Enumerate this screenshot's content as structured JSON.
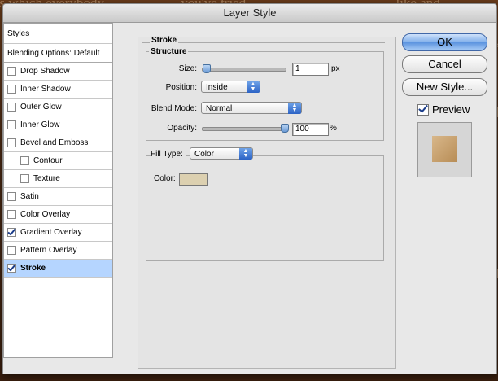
{
  "window": {
    "title": "Layer Style"
  },
  "styles_list": {
    "header": "Styles",
    "blending_options": "Blending Options: Default",
    "items": [
      {
        "label": "Drop Shadow",
        "checked": false,
        "indent": false
      },
      {
        "label": "Inner Shadow",
        "checked": false,
        "indent": false
      },
      {
        "label": "Outer Glow",
        "checked": false,
        "indent": false
      },
      {
        "label": "Inner Glow",
        "checked": false,
        "indent": false
      },
      {
        "label": "Bevel and Emboss",
        "checked": false,
        "indent": false
      },
      {
        "label": "Contour",
        "checked": false,
        "indent": true
      },
      {
        "label": "Texture",
        "checked": false,
        "indent": true
      },
      {
        "label": "Satin",
        "checked": false,
        "indent": false
      },
      {
        "label": "Color Overlay",
        "checked": false,
        "indent": false
      },
      {
        "label": "Gradient Overlay",
        "checked": true,
        "indent": false
      },
      {
        "label": "Pattern Overlay",
        "checked": false,
        "indent": false
      },
      {
        "label": "Stroke",
        "checked": true,
        "indent": false,
        "selected": true
      }
    ]
  },
  "stroke": {
    "section_title": "Stroke",
    "structure_title": "Structure",
    "size_label": "Size:",
    "size_value": "1",
    "size_unit": "px",
    "position_label": "Position:",
    "position_value": "Inside",
    "blend_label": "Blend Mode:",
    "blend_value": "Normal",
    "opacity_label": "Opacity:",
    "opacity_value": "100",
    "opacity_unit": "%",
    "opacity_level": 1.0,
    "size_level": 0.0,
    "fill_type_label": "Fill Type:",
    "fill_type_value": "Color",
    "color_label": "Color:",
    "color_value": "#dcd0b0"
  },
  "buttons": {
    "ok": "OK",
    "cancel": "Cancel",
    "new_style": "New Style..."
  },
  "preview": {
    "label": "Preview",
    "checked": true
  },
  "background": {
    "texts": [
      "es which everybody",
      "you've tried",
      "like and"
    ],
    "side_letters": [
      "e",
      "M",
      "M"
    ]
  }
}
